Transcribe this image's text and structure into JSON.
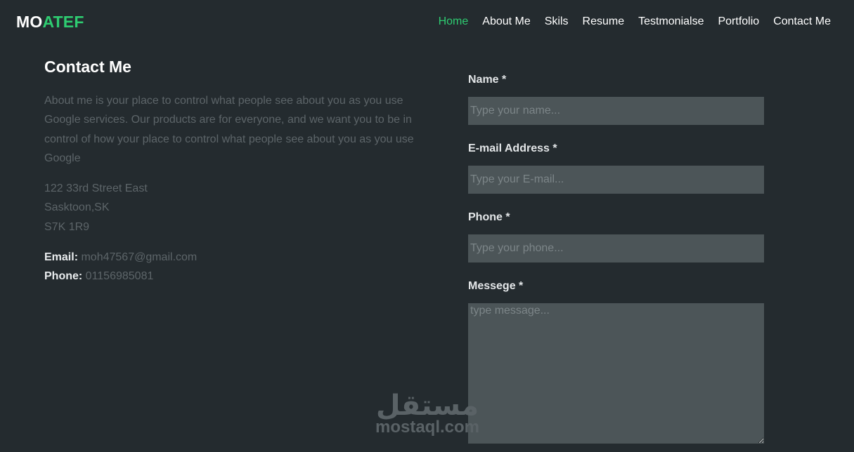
{
  "header": {
    "logo_part1": "MO",
    "logo_part2": "ATEF",
    "nav": [
      {
        "label": "Home",
        "active": true
      },
      {
        "label": "About Me"
      },
      {
        "label": "Skils"
      },
      {
        "label": "Resume"
      },
      {
        "label": "Testmonialse"
      },
      {
        "label": "Portfolio"
      },
      {
        "label": "Contact Me"
      }
    ]
  },
  "contact": {
    "title": "Contact Me",
    "about": "About me is your place to control what people see about you as you use Google services. Our products are for everyone, and we want you to be in control of how your place to control what people see about you as you use Google",
    "address": [
      "122 33rd Street East",
      "Sasktoon,SK",
      "S7K 1R9"
    ],
    "email_label": "Email:",
    "email": "moh47567@gmail.com",
    "phone_label": "Phone:",
    "phone": "01156985081"
  },
  "form": {
    "name_label": "Name *",
    "name_placeholder": "Type your name...",
    "email_label": "E-mail Address *",
    "email_placeholder": "Type your E-mail...",
    "phone_label": "Phone *",
    "phone_placeholder": "Type your phone...",
    "message_label": "Messege *",
    "message_placeholder": "type message..."
  },
  "watermark": {
    "arabic": "مستقل",
    "latin": "mostaql.com"
  },
  "colors": {
    "background": "#242b2f",
    "accent": "#2ecc71",
    "input_bg": "#4c5558"
  }
}
